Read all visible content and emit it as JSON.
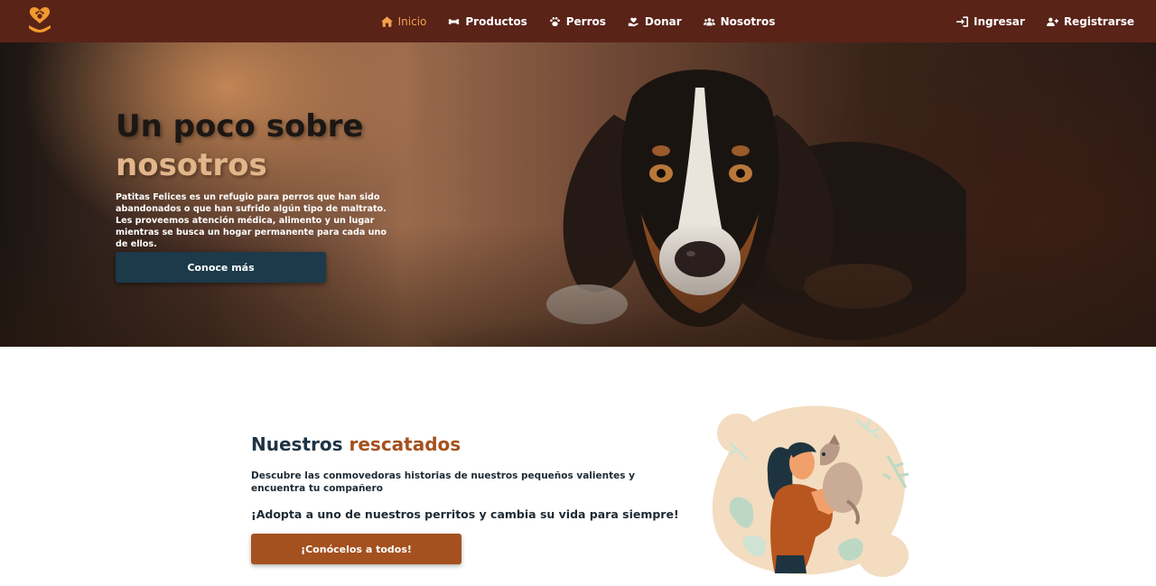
{
  "navbar": {
    "logo_icon": "paw-heart-logo-icon",
    "links": [
      {
        "label": "Inicio",
        "icon": "home-icon",
        "active": true
      },
      {
        "label": "Productos",
        "icon": "bone-icon",
        "active": false
      },
      {
        "label": "Perros",
        "icon": "paw-icon",
        "active": false
      },
      {
        "label": "Donar",
        "icon": "hand-heart-icon",
        "active": false
      },
      {
        "label": "Nosotros",
        "icon": "users-icon",
        "active": false
      }
    ],
    "auth": [
      {
        "label": "Ingresar",
        "icon": "sign-in-icon"
      },
      {
        "label": "Registrarse",
        "icon": "user-plus-icon"
      }
    ]
  },
  "hero": {
    "title_line1": "Un poco sobre",
    "title_line2": "nosotros",
    "description": "Patitas Felices es un refugio para perros que han sido abandonados o que han sufrido algún tipo de maltrato. Les proveemos atención médica, alimento y un lugar mientras se busca un hogar permanente para cada uno de ellos.",
    "button_label": "Conoce más"
  },
  "rescued": {
    "title_part1": "Nuestros ",
    "title_part2": "rescatados",
    "description": "Descubre las conmovedoras historias de nuestros pequeños valientes y encuentra tu compañero",
    "cta_text": "¡Adopta a uno de nuestros perritos y cambia su vida para siempre!",
    "button_label": "¡Conócelos a todos!"
  },
  "colors": {
    "navbar_bg": "#5a2318",
    "active_link": "#f0a24a",
    "hero_button": "#1c3a4a",
    "accent_brown": "#a4511f",
    "title_navy": "#1e3444",
    "hero_accent": "#e2b58a"
  }
}
